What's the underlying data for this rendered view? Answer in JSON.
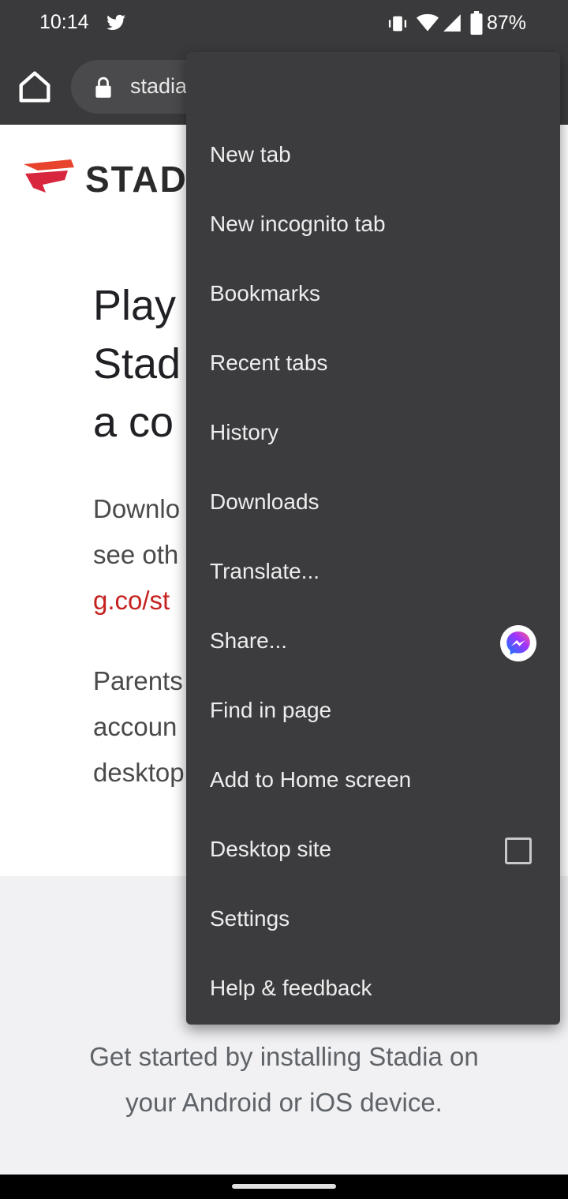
{
  "status_bar": {
    "time": "10:14",
    "battery": "87%",
    "icons": [
      "twitter-icon",
      "vibrate-icon",
      "wifi-icon",
      "signal-icon",
      "battery-icon"
    ]
  },
  "toolbar": {
    "url": "stadia",
    "icons": [
      "home-icon",
      "lock-icon",
      "forward-arrow-icon",
      "star-icon",
      "download-icon",
      "info-icon",
      "reload-icon"
    ]
  },
  "page": {
    "logo_text": "STAD",
    "headline": "Play\nStad\na co",
    "body1": "Downlo\nsee oth",
    "link": "g.co/st",
    "body2": "Parents\naccoun\ndesktop",
    "get_started": "Get started by installing Stadia on\nyour Android or iOS device."
  },
  "menu": {
    "items": [
      {
        "label": "New tab"
      },
      {
        "label": "New incognito tab"
      },
      {
        "label": "Bookmarks"
      },
      {
        "label": "Recent tabs"
      },
      {
        "label": "History"
      },
      {
        "label": "Downloads"
      },
      {
        "label": "Translate..."
      },
      {
        "label": "Share..."
      },
      {
        "label": "Find in page"
      },
      {
        "label": "Add to Home screen"
      },
      {
        "label": "Desktop site"
      },
      {
        "label": "Settings"
      },
      {
        "label": "Help & feedback"
      }
    ]
  },
  "colors": {
    "toolbar_bg": "#3a3a3c",
    "menu_bg": "#3c3c3f",
    "link_red": "#c5221f",
    "stadia_orange": "#e8432c"
  }
}
